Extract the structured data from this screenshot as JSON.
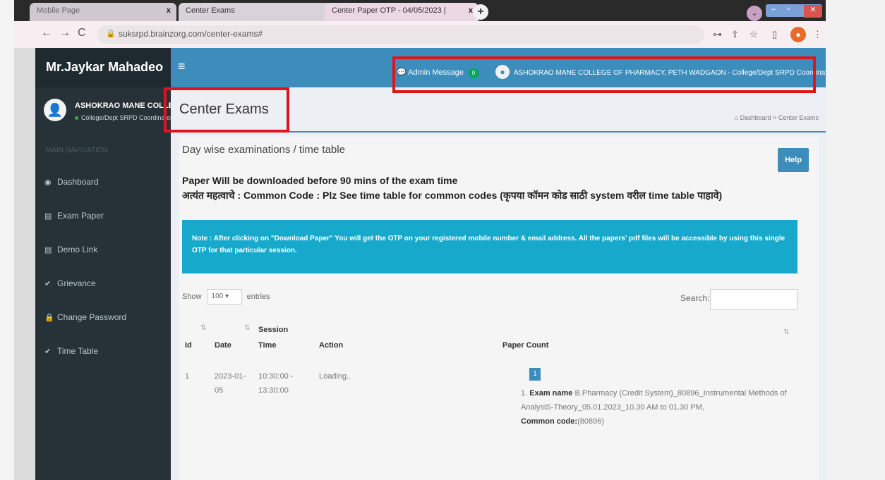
{
  "browser": {
    "tabs": [
      {
        "title": "Mobile Page",
        "close": "x"
      },
      {
        "title": "Center Exams",
        "close": "x"
      },
      {
        "title": "Center Paper OTP - 04/05/2023 |",
        "close": "x"
      }
    ],
    "new_tab": "+",
    "url": "suksrpd.brainzorg.com/center-exams#"
  },
  "sidebar": {
    "brand": "Mr.Jaykar Mahadeo",
    "user_name": "ASHOKRAO MANE COLLEGE",
    "user_role": "College/Dept SRPD Coordinator",
    "nav_header": "MAIN NAVIGATION",
    "items": [
      {
        "label": "Dashboard",
        "icon": "dashboard-icon"
      },
      {
        "label": "Exam Paper",
        "icon": "file-icon"
      },
      {
        "label": "Demo Link",
        "icon": "file-icon"
      },
      {
        "label": "Grievance",
        "icon": "check-icon"
      },
      {
        "label": "Change Password",
        "icon": "lock-icon"
      },
      {
        "label": "Time Table",
        "icon": "check-icon"
      }
    ]
  },
  "header": {
    "menu_toggle": "≡",
    "admin_message": "Admin Message",
    "admin_badge": "0",
    "college": "ASHOKRAO MANE COLLEGE OF PHARMACY, PETH WADGAON - College/Dept SRPD Coordinator"
  },
  "page": {
    "title": "Center Exams",
    "breadcrumb_home": "Dashboard",
    "breadcrumb_sep": ">",
    "breadcrumb_current": "Center Exams",
    "subtitle": "Day wise examinations / time table",
    "help_label": "Help",
    "line1": "Paper Will be downloaded before 90 mins of the exam time",
    "line2": "अत्यंत महत्वाचे : Common Code : Plz See time table for common codes (कृपया कॉमन कोड साठी system वरील time table पाहावे)",
    "note": "Note : After clicking on \"Download Paper\" You will get the OTP on your registered mobile number & email address. All the papers' pdf files will be accessible by using this single OTP for that particular session.",
    "show_label": "Show",
    "entries_value": "100",
    "entries_label": "entries",
    "search_label": "Search:"
  },
  "table": {
    "headers": {
      "id": "Id",
      "date": "Date",
      "session_1": "Session",
      "session_2": "Time",
      "action": "Action",
      "paper_count": "Paper Count"
    },
    "row": {
      "id": "1",
      "date_1": "2023-01-",
      "date_2": "05",
      "time_1": "10:30:00 -",
      "time_2": "13:30:00",
      "action": "Loading..",
      "page_btn": "1",
      "exam_prefix": "1.",
      "exam_name_label": "Exam name",
      "exam_name_1": "B.Pharmacy (Credit System)_80896_Instrumental Methods of",
      "exam_name_2": "AnalysiS-Theory_05.01.2023_10.30 AM to 01.30 PM,",
      "common_code_label": "Common code:",
      "common_code": "(80896)"
    }
  },
  "colors": {
    "header": "#3c8dbc",
    "sidebar": "#273138",
    "note": "#16a9cb",
    "highlight": "#e0151b"
  }
}
